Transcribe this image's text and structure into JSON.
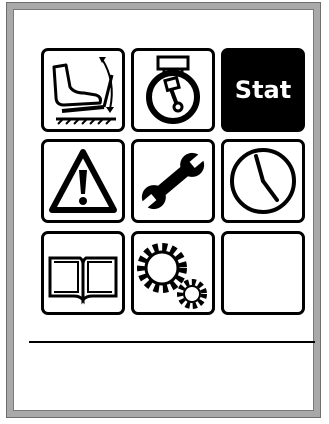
{
  "menu": {
    "items": [
      {
        "icon": "foot-pedal-icon"
      },
      {
        "icon": "engine-lift-icon"
      },
      {
        "icon": "stat-icon",
        "label": "Stat"
      },
      {
        "icon": "warning-icon"
      },
      {
        "icon": "wrench-icon"
      },
      {
        "icon": "clock-icon"
      },
      {
        "icon": "manual-book-icon"
      },
      {
        "icon": "gears-icon"
      },
      {
        "icon": "empty-slot"
      }
    ]
  },
  "colors": {
    "frame": "#a9a9a9",
    "screen": "#ffffff",
    "tile_border": "#000000",
    "stat_tile_bg": "#000000",
    "stat_tile_text": "#ffffff"
  }
}
